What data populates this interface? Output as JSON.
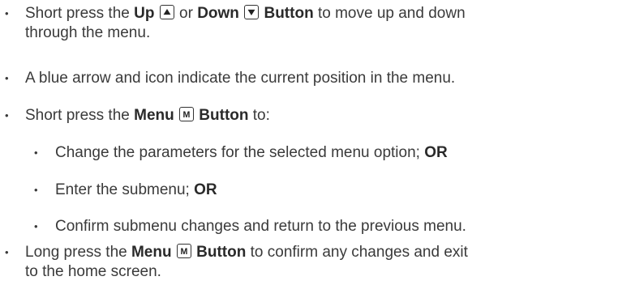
{
  "bullets": [
    {
      "pre": "Short press the ",
      "up_label": "Up",
      "or_word": " or ",
      "down_label": "Down",
      "button_word": " Button",
      "post": " to move up and down",
      "line2": "through the menu."
    },
    {
      "text": "A blue arrow and icon indicate the current position in the menu."
    },
    {
      "pre": "Short press the ",
      "menu_label": "Menu",
      "button_word": "Button",
      "post": " to:"
    },
    {
      "pre": "Long press the ",
      "menu_label": "Menu",
      "button_word": "Button",
      "post": " to confirm any changes and exit",
      "line2": "to the home screen."
    }
  ],
  "sub_bullets": [
    {
      "text": "Change the parameters for the selected menu option; ",
      "bold": "OR"
    },
    {
      "text": "Enter the submenu; ",
      "bold": "OR"
    },
    {
      "text": "Confirm submenu changes and return to the previous menu.",
      "bold": ""
    }
  ],
  "key_icons": {
    "up": "up-triangle-icon",
    "down": "down-triangle-icon",
    "menu": "menu-m-icon"
  },
  "menu_key_letter": "M"
}
